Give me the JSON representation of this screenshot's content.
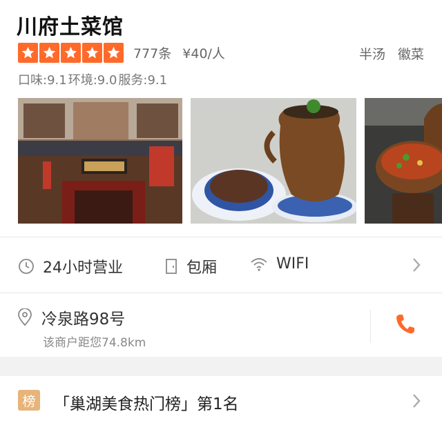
{
  "shop": {
    "name": "川府土菜馆",
    "rating_stars": 5,
    "review_count": "777条",
    "price": "¥40/人",
    "tags": [
      "半汤",
      "徽菜"
    ],
    "scores": {
      "taste": "口味:9.1",
      "environment": "环境:9.0",
      "service": "服务:9.1"
    }
  },
  "features": {
    "hours": "24小时营业",
    "room": "包厢",
    "wifi": "WIFI"
  },
  "address": {
    "street": "冷泉路98号",
    "distance": "该商户距您74.8km"
  },
  "ranking": {
    "badge": "榜",
    "text": "「巢湖美食热门榜」第1名"
  },
  "colors": {
    "star": "#ff6a2a",
    "phone": "#ff6a2a",
    "badge": "#e7b47a"
  }
}
